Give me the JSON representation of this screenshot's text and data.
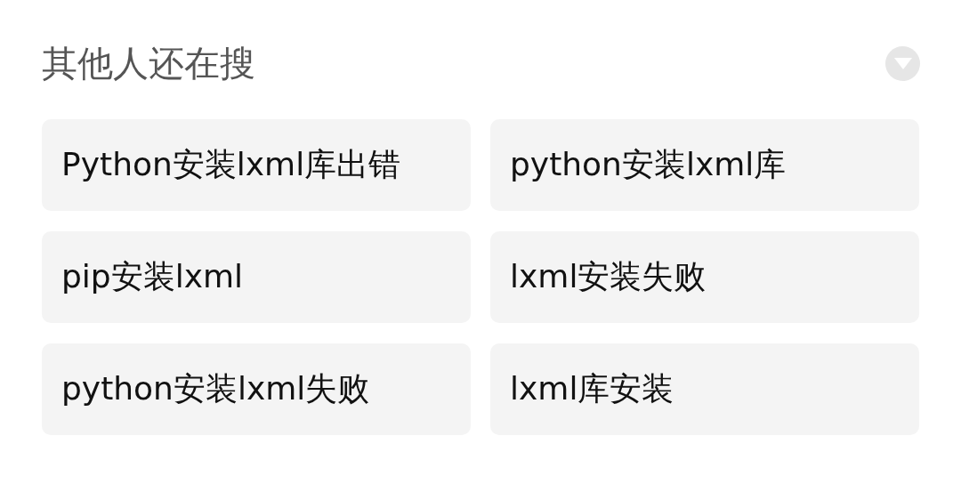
{
  "section": {
    "title": "其他人还在搜",
    "expanded": true
  },
  "suggestions": [
    {
      "label": "Python安装lxml库出错"
    },
    {
      "label": "python安装lxml库"
    },
    {
      "label": "pip安装lxml"
    },
    {
      "label": "lxml安装失败"
    },
    {
      "label": "python安装lxml失败"
    },
    {
      "label": "lxml库安装"
    }
  ]
}
